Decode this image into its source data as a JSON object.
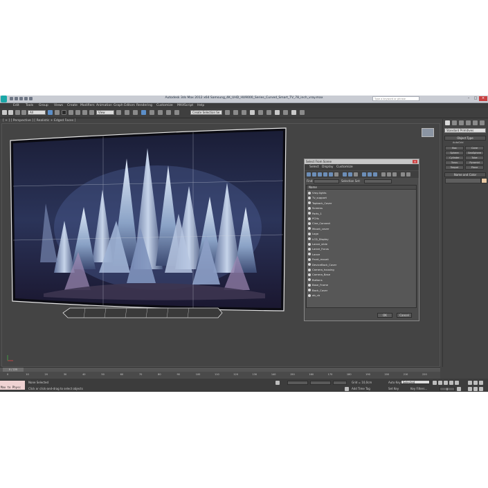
{
  "window": {
    "title": "Autodesk 3ds Max  2012 x64      Samsung_4K_UHD_HU9000_Series_Curved_Smart_TV_78_inch_vray.max",
    "search_placeholder": "Type a keyword or phrase",
    "min": "–",
    "max": "□",
    "close": "×"
  },
  "menu": [
    "Edit",
    "Tools",
    "Group",
    "Views",
    "Create",
    "Modifiers",
    "Animation",
    "Graph Editors",
    "Rendering",
    "Customize",
    "MAXScript",
    "Help"
  ],
  "toolbar": {
    "filter_value": "All",
    "view_value": "View",
    "selection_set_placeholder": "Create Selection Se"
  },
  "viewport": {
    "label": "[ + ] [ Perspective ] [ Realistic + Edged Faces ]"
  },
  "command_panel": {
    "dropdown": "Standard Primitives",
    "object_type": "Object Type",
    "autogrid": "AutoGrid",
    "buttons": [
      "Box",
      "Cone",
      "Sphere",
      "GeoSphere",
      "Cylinder",
      "Tube",
      "Torus",
      "Pyramid",
      "Teapot",
      "Plane"
    ],
    "name_and_color": "Name and Color"
  },
  "dialog": {
    "title": "Select From Scene",
    "close": "×",
    "menu": [
      "Select",
      "Display",
      "Customize"
    ],
    "find_label": "Find:",
    "selection_sets_label": "Selection Set:",
    "column_name": "Name",
    "items": [
      "Vray-lights",
      "Tv_support",
      "Topback_Cover",
      "Screens",
      "Parts_1",
      "PCHs",
      "Cine_Connect",
      "Mount_cover",
      "Logo",
      "LCD_Display",
      "Lance_slide",
      "Lance_Focus",
      "Lance",
      "Front_mount",
      "DeviceBack_Cover",
      "Camera_housing",
      "Camera_Base",
      "Buttons",
      "Base_Frame",
      "Back_Cover",
      "ab_cb"
    ],
    "ok": "OK",
    "cancel": "Cancel"
  },
  "timeline": {
    "slider_label": "0 / 225",
    "ticks": [
      "0",
      "10",
      "20",
      "30",
      "40",
      "50",
      "60",
      "70",
      "80",
      "90",
      "100",
      "110",
      "120",
      "130",
      "140",
      "150",
      "160",
      "170",
      "180",
      "190",
      "200",
      "210",
      "220"
    ]
  },
  "status": {
    "maxscript_label": "Max to Physc",
    "selection": "None Selected",
    "prompt": "Click or click-and-drag to select objects",
    "grid": "Grid = 10,0cm",
    "add_time_tag": "Add Time Tag",
    "auto_key": "Auto Key",
    "auto_key_value": "Selected",
    "set_key": "Set Key",
    "key_filters": "Key Filters...",
    "frame": "0"
  }
}
